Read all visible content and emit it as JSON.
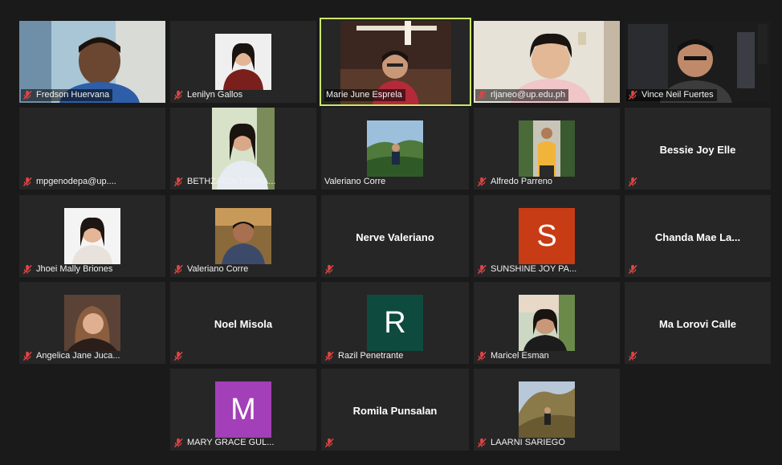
{
  "colors": {
    "background": "#1a1a1a",
    "tile": "#262626",
    "active_border": "#c9e76a",
    "mute_icon": "#e04545",
    "avatar_s": "#c73c14",
    "avatar_r": "#0e4b3e",
    "avatar_m": "#a33fb8"
  },
  "participants": [
    {
      "name": "Fredson Huervana",
      "muted": true,
      "type": "video"
    },
    {
      "name": "Lenilyn Gallos",
      "muted": true,
      "type": "photo"
    },
    {
      "name": "Marie June Esprela",
      "muted": false,
      "type": "video",
      "active_speaker": true
    },
    {
      "name": "rljaneo@up.edu.ph",
      "muted": true,
      "type": "video"
    },
    {
      "name": "Vince Neil Fuertes",
      "muted": true,
      "type": "video"
    },
    {
      "name": "mpgenodepa@up....",
      "muted": true,
      "type": "blank"
    },
    {
      "name": "BETHZAIDA TERRA...",
      "muted": true,
      "type": "photo"
    },
    {
      "name": "Valeriano Corre",
      "muted": false,
      "type": "photo"
    },
    {
      "name": "Alfredo Parreno",
      "muted": true,
      "type": "photo"
    },
    {
      "name": "Bessie Joy Elle",
      "muted": true,
      "type": "name"
    },
    {
      "name": "Jhoei Mally Briones",
      "muted": true,
      "type": "photo"
    },
    {
      "name": "Valeriano Corre",
      "muted": true,
      "type": "photo"
    },
    {
      "name": "Nerve Valeriano",
      "muted": true,
      "type": "name"
    },
    {
      "name": "SUNSHINE JOY PA...",
      "muted": true,
      "type": "avatar",
      "letter": "S"
    },
    {
      "name": "Chanda  Mae  La...",
      "muted": true,
      "type": "name"
    },
    {
      "name": "Angelica Jane Juca...",
      "muted": true,
      "type": "photo"
    },
    {
      "name": "Noel Misola",
      "muted": true,
      "type": "name"
    },
    {
      "name": "Razil Penetrante",
      "muted": true,
      "type": "avatar",
      "letter": "R"
    },
    {
      "name": "Maricel Esman",
      "muted": true,
      "type": "photo"
    },
    {
      "name": "Ma Lorovi Calle",
      "muted": true,
      "type": "name"
    },
    {
      "name": "MARY GRACE GUL...",
      "muted": true,
      "type": "avatar",
      "letter": "M"
    },
    {
      "name": "Romila Punsalan",
      "muted": true,
      "type": "name"
    },
    {
      "name": "LAARNI SARIEGO",
      "muted": true,
      "type": "photo"
    }
  ]
}
